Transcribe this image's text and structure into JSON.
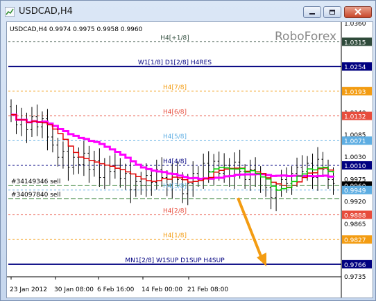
{
  "window": {
    "title": "USDCAD,H4"
  },
  "colors": {
    "level_dark": "#000080",
    "level_red": "#e74c3c",
    "level_orange": "#f39c12",
    "level_blue": "#5dade2",
    "ma_fast": "#e00000",
    "ma_slow": "#ff00ff",
    "ma_mid": "#00cc00",
    "arrow": "#f39c12"
  },
  "chart": {
    "header": "USDCAD,H4  0.9974 0.9975 0.9958 0.9960",
    "watermark": "RoboForex",
    "price_min": 0.9735,
    "price_max": 1.036,
    "axis_ticks": [
      "1.0360",
      "1.0140",
      "1.0085",
      "1.0030",
      "0.9975",
      "0.9920",
      "0.9865",
      "0.9735"
    ],
    "price_tags": [
      {
        "value": "1.0315",
        "bg": "#2e4a3a",
        "fg": "#ffffff",
        "price": 1.0315
      },
      {
        "value": "1.0254",
        "bg": "#000080",
        "fg": "#ffffff",
        "price": 1.0254
      },
      {
        "value": "1.0193",
        "bg": "#f39c12",
        "fg": "#ffffff",
        "price": 1.0193
      },
      {
        "value": "1.0132",
        "bg": "#e74c3c",
        "fg": "#ffffff",
        "price": 1.0132
      },
      {
        "value": "1.0071",
        "bg": "#5dade2",
        "fg": "#ffffff",
        "price": 1.0071
      },
      {
        "value": "1.0010",
        "bg": "#000080",
        "fg": "#ffffff",
        "price": 1.001
      },
      {
        "value": "0.9960",
        "bg": "#000000",
        "fg": "#ffffff",
        "price": 0.996
      },
      {
        "value": "0.9949",
        "bg": "#5dade2",
        "fg": "#ffffff",
        "price": 0.9949
      },
      {
        "value": "0.9888",
        "bg": "#e74c3c",
        "fg": "#ffffff",
        "price": 0.9888
      },
      {
        "value": "0.9827",
        "bg": "#f39c12",
        "fg": "#ffffff",
        "price": 0.9827
      },
      {
        "value": "0.9766",
        "bg": "#000080",
        "fg": "#ffffff",
        "price": 0.9766
      }
    ],
    "levels": [
      {
        "label": "H4[+1/8]",
        "price": 1.0315,
        "color": "#2e4a3a",
        "style": "dash"
      },
      {
        "label": "W1[1/8] D1[2/8] H4RES",
        "price": 1.0254,
        "color": "#000080",
        "style": "solid"
      },
      {
        "label": "H4[7/8]",
        "price": 1.0193,
        "color": "#f39c12",
        "style": "dash"
      },
      {
        "label": "H4[6/8]",
        "price": 1.0132,
        "color": "#e74c3c",
        "style": "dash"
      },
      {
        "label": "H4[5/8]",
        "price": 1.0071,
        "color": "#5dade2",
        "style": "dash"
      },
      {
        "label": "H4[4/8]",
        "price": 1.001,
        "color": "#000080",
        "style": "dash"
      },
      {
        "label": "H4[3/8]",
        "price": 0.9949,
        "color": "#5dade2",
        "style": "dash"
      },
      {
        "label": "H4[2/8]",
        "price": 0.9888,
        "color": "#e74c3c",
        "style": "dash"
      },
      {
        "label": "H4[1/8]",
        "price": 0.9827,
        "color": "#f39c12",
        "style": "dash"
      },
      {
        "label": "MN1[2/8] W1SUP D1SUP H4SUP",
        "price": 0.9766,
        "color": "#000080",
        "style": "solid"
      }
    ],
    "orders": [
      {
        "label": "#34149346 sell",
        "price": 0.996
      },
      {
        "label": "#34097840 sell",
        "price": 0.9928
      }
    ],
    "x_labels": [
      "23 Jan 2012",
      "30 Jan 08:00",
      "6 Feb 16:00",
      "14 Feb 00:00",
      "21 Feb 08:00"
    ],
    "close": [
      1.0135,
      1.011,
      1.0122,
      1.0098,
      1.013,
      1.0105,
      1.0125,
      1.008,
      1.006,
      1.003,
      1.0045,
      1.0005,
      1.003,
      1.0012,
      1.004,
      1.0,
      1.0022,
      0.998,
      1.001,
      0.9995,
      1.001,
      0.9978,
      0.999,
      0.995,
      0.997,
      0.996,
      0.9985,
      0.9968,
      1.0,
      0.998,
      0.9962,
      0.999,
      0.9975,
      0.994,
      0.9965,
      0.999,
      0.9975,
      1.0015,
      0.9995,
      1.002,
      0.999,
      1.001,
      0.9985,
      1.0018,
      0.9995,
      0.9975,
      1.0,
      0.999,
      0.996,
      0.9955,
      0.993,
      0.995,
      0.9975,
      0.9965,
      0.999,
      1.0005,
      0.9995,
      1.0015,
      0.998,
      1.0025,
      1.0,
      0.9975,
      0.9965
    ]
  }
}
